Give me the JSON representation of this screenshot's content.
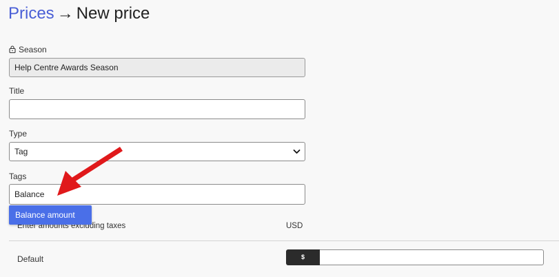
{
  "breadcrumb": {
    "parent": "Prices",
    "separator": "→",
    "current": "New price"
  },
  "form": {
    "season": {
      "label": "Season",
      "value": "Help Centre Awards Season"
    },
    "title": {
      "label": "Title",
      "value": ""
    },
    "type": {
      "label": "Type",
      "value": "Tag"
    },
    "tags": {
      "label": "Tags",
      "value": "Balance",
      "suggestion": "Balance amount"
    }
  },
  "amounts": {
    "note": "Enter amounts excluding taxes",
    "currency": "USD",
    "default_label": "Default",
    "currency_symbol": "$",
    "default_value": ""
  },
  "colors": {
    "link": "#4a5fd6",
    "suggestion_bg": "#4a6fe8",
    "annotation": "#e0191b"
  }
}
